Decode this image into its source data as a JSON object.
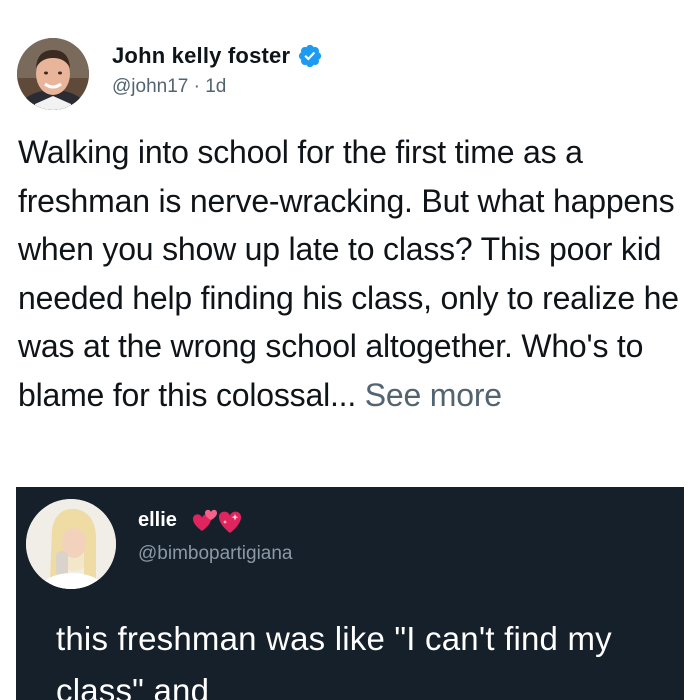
{
  "post": {
    "author_name": "John kelly foster",
    "handle": "@john17",
    "separator": "·",
    "time": "1d",
    "body_text": "Walking into school for the first time as a freshman is nerve-wracking. But what happens when you show up late to class? This poor kid needed help finding his class, only to realize he was at the wrong school altogether. Who's to blame for this colossal...",
    "see_more": "See more",
    "verified_icon": "verified-badge-icon",
    "accent_color": "#1d9bf0"
  },
  "embedded_tweet": {
    "name": "ellie",
    "handle": "@bimbopartigiana",
    "emoji_icon": "hearts-emoji-icon",
    "text": "this freshman was like \"I can't find my class\" and",
    "background_color": "#15202b"
  }
}
